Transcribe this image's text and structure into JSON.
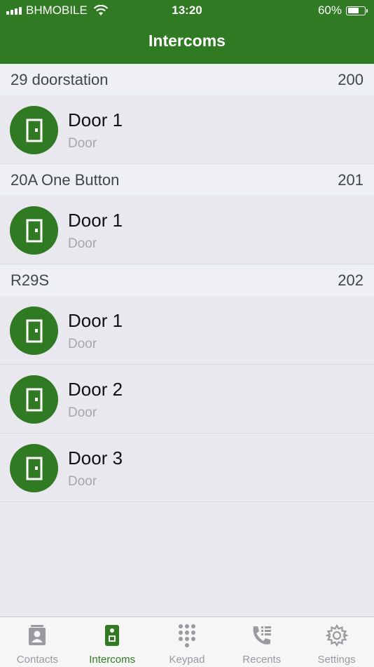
{
  "status_bar": {
    "carrier": "BHMOBILE",
    "time": "13:20",
    "battery": "60%"
  },
  "header": {
    "title": "Intercoms"
  },
  "sections": [
    {
      "name": "29 doorstation",
      "number": "200",
      "items": [
        {
          "name": "Door 1",
          "type": "Door"
        }
      ]
    },
    {
      "name": "20A One Button",
      "number": "201",
      "items": [
        {
          "name": "Door 1",
          "type": "Door"
        }
      ]
    },
    {
      "name": "R29S",
      "number": "202",
      "items": [
        {
          "name": "Door 1",
          "type": "Door"
        },
        {
          "name": "Door 2",
          "type": "Door"
        },
        {
          "name": "Door 3",
          "type": "Door"
        }
      ]
    }
  ],
  "tabs": [
    {
      "label": "Contacts",
      "icon": "contacts-icon",
      "active": false
    },
    {
      "label": "Intercoms",
      "icon": "intercom-icon",
      "active": true
    },
    {
      "label": "Keypad",
      "icon": "keypad-icon",
      "active": false
    },
    {
      "label": "Recents",
      "icon": "recents-icon",
      "active": false
    },
    {
      "label": "Settings",
      "icon": "gear-icon",
      "active": false
    }
  ],
  "colors": {
    "brand": "#2f7a22",
    "inactive": "#9a9aa0"
  }
}
